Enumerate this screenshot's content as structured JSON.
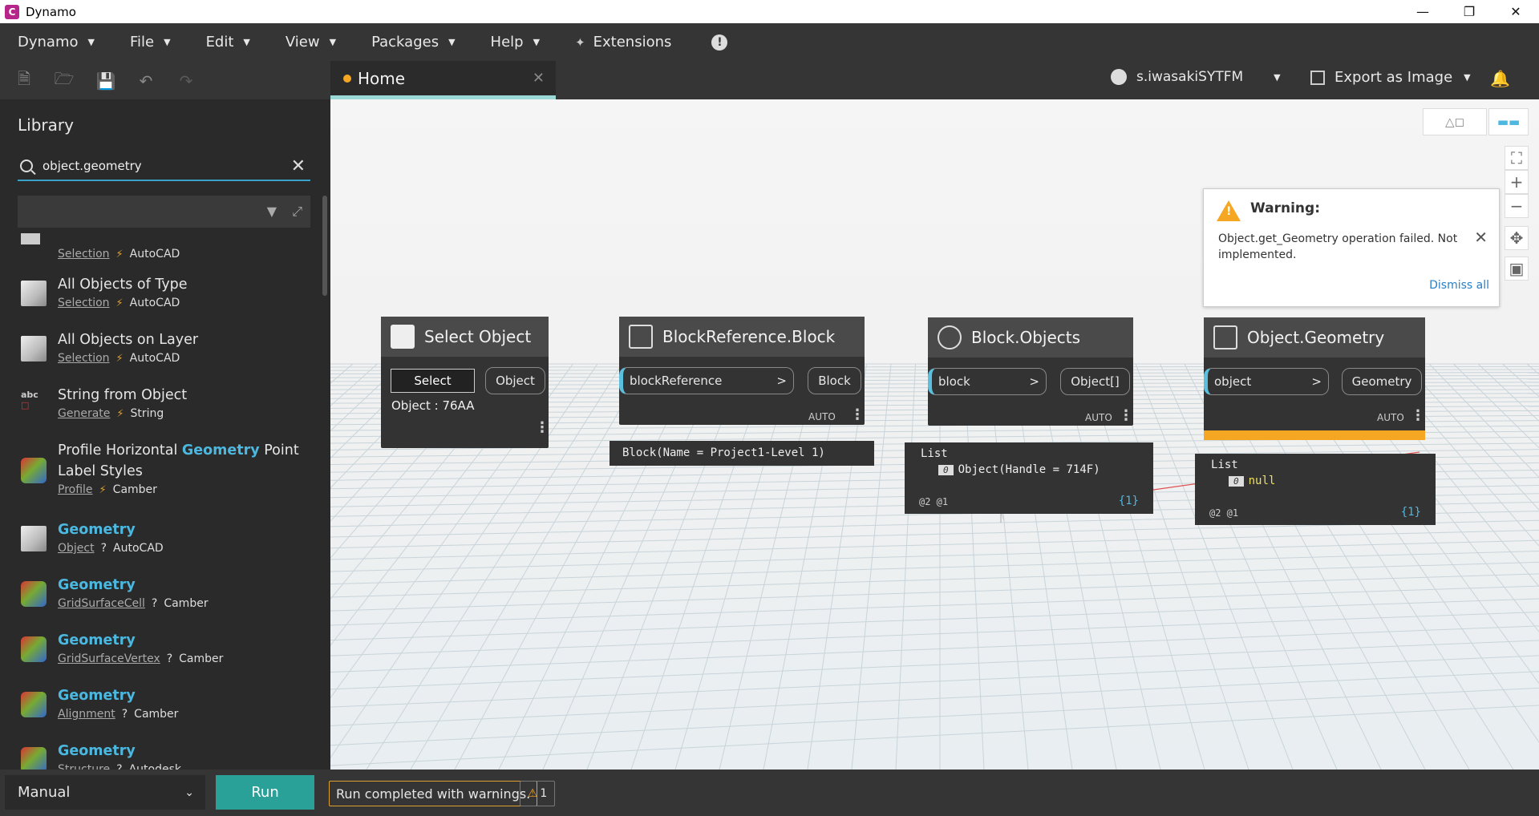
{
  "window": {
    "title": "Dynamo",
    "app_icon": "C"
  },
  "menubar": {
    "items": [
      "Dynamo",
      "File",
      "Edit",
      "View",
      "Packages",
      "Help"
    ],
    "extensions_label": "Extensions"
  },
  "tab": {
    "label": "Home"
  },
  "user": {
    "name": "s.iwasakiSYTFM"
  },
  "export": {
    "label": "Export as Image"
  },
  "library": {
    "title": "Library",
    "search_value": "object.geometry",
    "items": [
      {
        "name": "",
        "category": "Selection",
        "package": "AutoCAD"
      },
      {
        "name": "All Objects of Type",
        "category": "Selection",
        "package": "AutoCAD"
      },
      {
        "name": "All Objects on Layer",
        "category": "Selection",
        "package": "AutoCAD"
      },
      {
        "name": "String from Object",
        "category": "Generate",
        "package": "String"
      },
      {
        "name_pre": "Profile Horizontal ",
        "name_hl": "Geometry",
        "name_post": " Point",
        "name_line2": "Label Styles",
        "category": "Profile",
        "package": "Camber"
      },
      {
        "name": "Geometry",
        "category": "Object",
        "package": "AutoCAD"
      },
      {
        "name": "Geometry",
        "category": "GridSurfaceCell",
        "package": "Camber"
      },
      {
        "name": "Geometry",
        "category": "GridSurfaceVertex",
        "package": "Camber"
      },
      {
        "name": "Geometry",
        "category": "Alignment",
        "package": "Camber"
      },
      {
        "name": "Geometry",
        "category": "Structure",
        "package": "Autodesk"
      }
    ]
  },
  "nodes": {
    "select_object": {
      "title": "Select Object",
      "button": "Select",
      "output": "Object",
      "value": "Object : 76AA"
    },
    "block_reference": {
      "title": "BlockReference.Block",
      "input": "blockReference",
      "output": "Block",
      "auto": "AUTO",
      "preview": "Block(Name = Project1-Level 1)"
    },
    "block_objects": {
      "title": "Block.Objects",
      "input": "block",
      "output": "Object[]",
      "auto": "AUTO",
      "preview_list": "List",
      "preview_index": "0",
      "preview_item": "Object(Handle = 714F)",
      "preview_levels": "@2 @1",
      "preview_count": "{1}"
    },
    "object_geometry": {
      "title": "Object.Geometry",
      "input": "object",
      "output": "Geometry",
      "auto": "AUTO",
      "preview_list": "List",
      "preview_index": "0",
      "preview_item": "null",
      "preview_levels": "@2 @1",
      "preview_count": "{1}"
    }
  },
  "warning": {
    "title": "Warning:",
    "message": "Object.get_Geometry operation failed. Not implemented.",
    "dismiss": "Dismiss all"
  },
  "bottom": {
    "run_mode": "Manual",
    "run_button": "Run",
    "status": "Run completed with warnings.",
    "warning_count": "1"
  },
  "colors": {
    "accent": "#2aa198",
    "warning": "#f5a623",
    "highlight": "#4cb8e0",
    "tab_underline": "#9ad9d6"
  }
}
